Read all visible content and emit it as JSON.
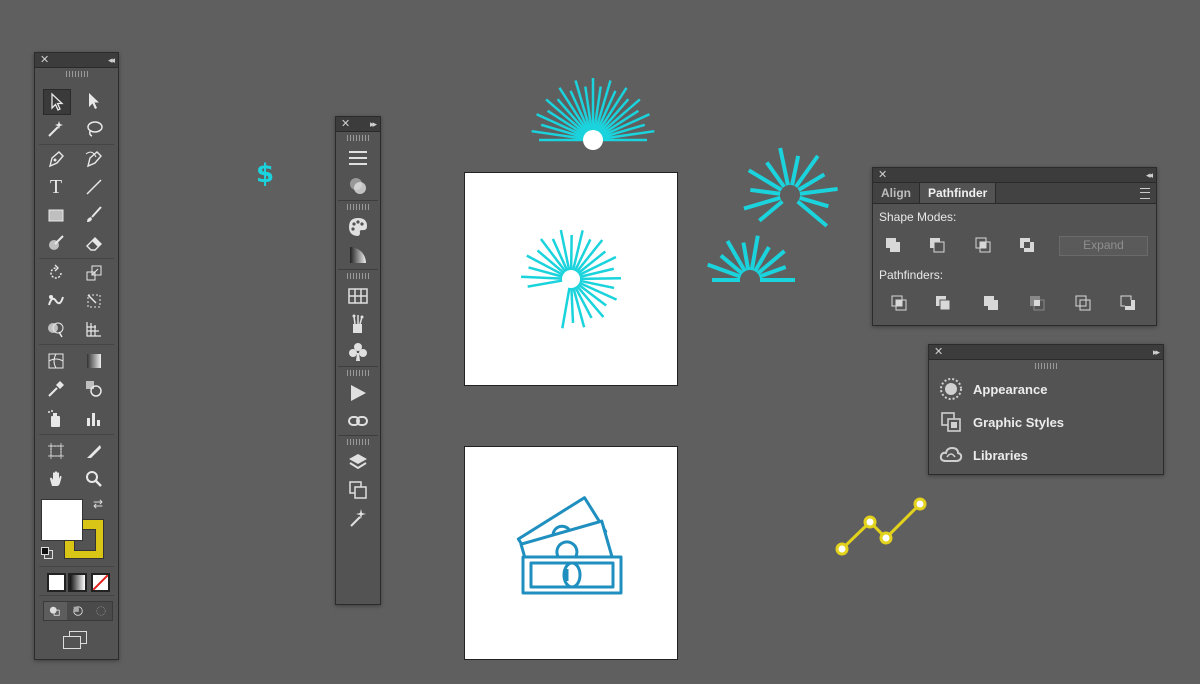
{
  "toolbar": {
    "tools": [
      "selection-tool",
      "direct-selection-tool",
      "magic-wand-tool",
      "lasso-tool",
      "pen-tool",
      "curvature-tool",
      "type-tool",
      "line-segment-tool",
      "rectangle-tool",
      "paintbrush-tool",
      "shaper-tool",
      "eraser-tool",
      "rotate-tool",
      "scale-tool",
      "puppet-warp-tool",
      "free-transform-tool",
      "shape-builder-tool",
      "perspective-grid-tool",
      "mesh-tool",
      "gradient-tool",
      "eyedropper-tool",
      "blend-tool",
      "symbol-sprayer-tool",
      "column-graph-tool",
      "artboard-tool",
      "slice-tool",
      "hand-tool",
      "zoom-tool"
    ],
    "fill_color": "#ffffff",
    "stroke_color": "#d8c515",
    "text_glyph": "T"
  },
  "dock": {
    "items": [
      "properties-icon",
      "transparency-icon",
      "color-guide-icon",
      "gradient-icon",
      "swatches-icon",
      "brushes-icon",
      "symbols-icon",
      "actions-icon",
      "links-icon",
      "layers-icon",
      "artboards-icon",
      "asset-export-icon"
    ]
  },
  "pathfinder_panel": {
    "tabs": [
      "Align",
      "Pathfinder"
    ],
    "active_tab": "Pathfinder",
    "shape_modes_label": "Shape Modes:",
    "pathfinders_label": "Pathfinders:",
    "expand_label": "Expand",
    "shape_modes": [
      "unite",
      "minus-front",
      "intersect",
      "exclude"
    ],
    "pathfinders": [
      "divide",
      "trim",
      "merge",
      "crop",
      "outline",
      "minus-back"
    ]
  },
  "libraries_panel": {
    "items": [
      {
        "label": "Appearance",
        "icon": "appearance-icon"
      },
      {
        "label": "Graphic Styles",
        "icon": "graphic-styles-icon"
      },
      {
        "label": "Libraries",
        "icon": "libraries-icon"
      }
    ]
  },
  "canvas": {
    "dollar_sign": "$",
    "accent_cyan": "#1ad3dc",
    "accent_blue": "#1f8fbf",
    "accent_yellow": "#e3d21c"
  }
}
